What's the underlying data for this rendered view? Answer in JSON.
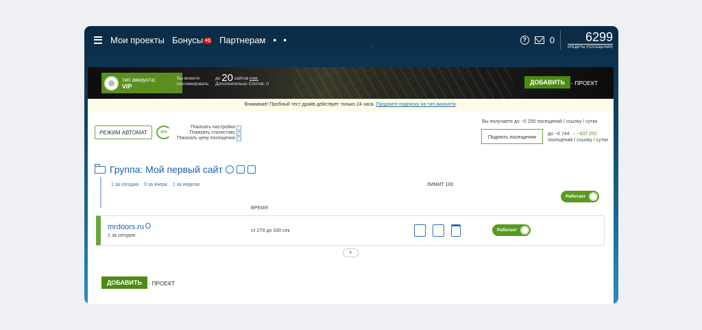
{
  "topbar": {
    "nav": [
      "Мои проекты",
      "Бонусы",
      "Партнерам"
    ],
    "bonus_badge": "+1",
    "dots": "• •",
    "mail_count": "0",
    "credits": "6299",
    "credits_label": "КРЕДИТЫ (ПОСЕЩЕНИЯ)"
  },
  "banner": {
    "account_type_label": "тип аккаунта:",
    "account_type": "VIP",
    "promo_text": "Вы можете рекламировать",
    "promo_prefix": "до",
    "promo_number": "20",
    "promo_unit": "сайтов",
    "promo_link": "изм.",
    "promo_slots": "Дополнительно Слотов: 0",
    "add_label": "ДОБАВИТЬ",
    "project_label": "- ПРОЕКТ"
  },
  "warning": {
    "text": "Внимание! Пробный тест драйв действует только 24 часа.",
    "link": "Продлите подписку на тип аккаунта",
    "tail": "."
  },
  "controls": {
    "mode_button": "РЕЖИМ АВТОМАТ",
    "afk": "AFK",
    "options": [
      {
        "label": "Показать настройки",
        "checked": false
      },
      {
        "label": "Показать статистику",
        "checked": true
      },
      {
        "label": "Показать цену посещения",
        "checked": false
      }
    ],
    "visits_info": "Вы получаете до ~5 255 посещений / ссылку / сутки",
    "raise_button": "Поднять посещения",
    "raise_line1_prefix": "до ~6 744 →",
    "raise_line1_value": "~537 252",
    "raise_line2": "посещений / ссылку / сутки"
  },
  "group": {
    "title": "Группа: Мой первый сайт",
    "stats": [
      "1 за сегодня",
      "0 за вчера",
      "1 за неделю"
    ],
    "limit": "ЛИМИТ 100",
    "status": "Работает",
    "time_col": "ВРЕМЯ"
  },
  "site": {
    "name": "mrdoors.ru",
    "sub": "1 за сегодня",
    "time": "от 270 до 330 сек",
    "status": "Работает"
  },
  "bottom": {
    "plus": "+",
    "add_label": "ДОБАВИТЬ",
    "project_label": "- ПРОЕКТ"
  }
}
